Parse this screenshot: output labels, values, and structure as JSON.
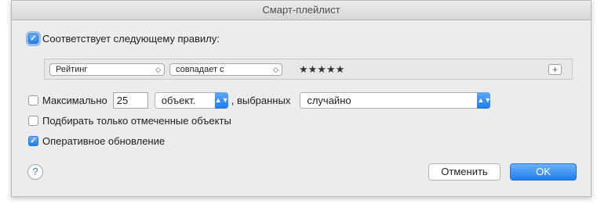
{
  "window": {
    "title": "Смарт-плейлист"
  },
  "match_rule": {
    "checked": true,
    "label": "Соответствует следующему правилу:"
  },
  "rule": {
    "field": "Рейтинг",
    "operator": "совпадает с",
    "stars": "★★★★★"
  },
  "limit": {
    "checked": false,
    "label": "Максимально",
    "value": "25",
    "unit": "объект.",
    "selected_by_label": ", выбранных",
    "selected_by": "случайно"
  },
  "checked_only": {
    "checked": false,
    "label": "Подбирать только отмеченные объекты"
  },
  "live_update": {
    "checked": true,
    "label": "Оперативное обновление"
  },
  "help": {
    "glyph": "?"
  },
  "buttons": {
    "cancel": "Отменить",
    "ok": "OK"
  },
  "colors": {
    "accent": "#1f7df1",
    "window_bg": "#ececec"
  }
}
